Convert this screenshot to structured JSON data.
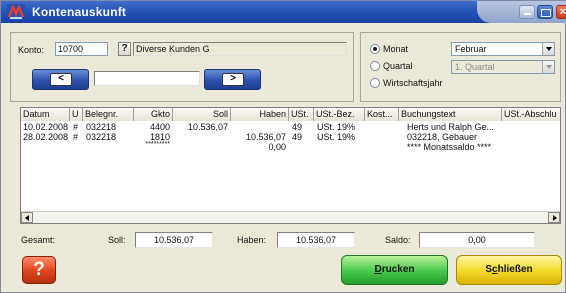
{
  "window": {
    "title": "Kontenauskunft"
  },
  "konto": {
    "label": "Konto:",
    "number": "10700",
    "help_label": "?",
    "name": "Diverse Kunden G",
    "prev_label": "<",
    "next_label": ">"
  },
  "period": {
    "options": [
      {
        "label": "Monat",
        "selected": true
      },
      {
        "label": "Quartal",
        "selected": false
      },
      {
        "label": "Wirtschaftsjahr",
        "selected": false
      }
    ],
    "month_value": "Februar",
    "quarter_value": "1. Quartal"
  },
  "table": {
    "columns": [
      "Datum",
      "U",
      "Belegnr.",
      "Gkto",
      "Soll",
      "Haben",
      "USt.",
      "USt.-Bez.",
      "Kost...",
      "Buchungstext",
      "USt.-Abschlu"
    ],
    "rows": [
      {
        "datum": "10.02.2008",
        "u": "#",
        "beleg": "032218",
        "gkto": "4400",
        "soll": "10.536,07",
        "haben": "",
        "ust": "49",
        "ustbez": "USt. 19%",
        "kost": "",
        "text": "Herts und Ralph Ge..."
      },
      {
        "datum": "28.02.2008",
        "u": "#",
        "beleg": "032218",
        "gkto": "1810",
        "soll": "",
        "haben": "10.536,07",
        "ust": "49",
        "ustbez": "USt. 19%",
        "kost": "",
        "text": "032218, Gebauer"
      },
      {
        "datum": "",
        "u": "",
        "beleg": "",
        "gkto": "*********",
        "soll": "",
        "haben": "0,00",
        "ust": "",
        "ustbez": "",
        "kost": "",
        "text": "**** Monatssaldo ****"
      }
    ]
  },
  "totals": {
    "gesamt_label": "Gesamt:",
    "soll_label": "Soll:",
    "soll_value": "10.536,07",
    "haben_label": "Haben:",
    "haben_value": "10.536,07",
    "saldo_label": "Saldo:",
    "saldo_value": "0,00"
  },
  "buttons": {
    "help_label": "?",
    "print_label": "Drucken",
    "print_accel": "D",
    "print_rest": "rucken",
    "close_pre": "S",
    "close_accel": "c",
    "close_rest": "hließen"
  },
  "colors": {
    "title_bar": "#2150b6",
    "print_button": "#48c84a",
    "close_button": "#f4d826",
    "help_button": "#e0431e"
  }
}
